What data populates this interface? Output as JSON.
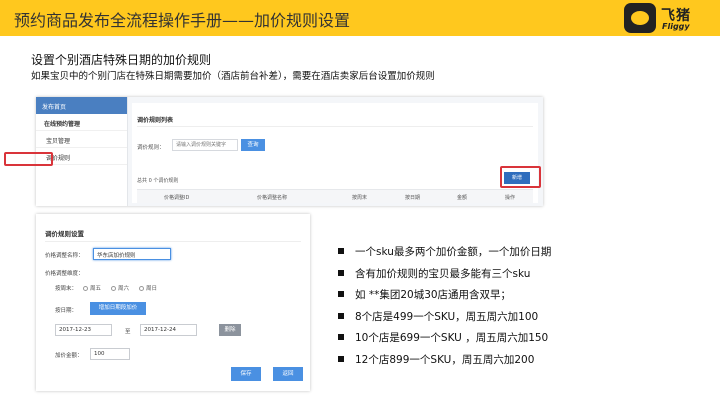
{
  "header": {
    "title": "预约商品发布全流程操作手册——加价规则设置",
    "logo_cn": "飞猪",
    "logo_en": "Fliggy"
  },
  "intro": {
    "heading": "设置个别酒店特殊日期的加价规则",
    "description": "如果宝贝中的个别门店在特殊日期需要加价（酒店前台补差），需要在酒店卖家后台设置加价规则"
  },
  "screenshot_list": {
    "sidebar": {
      "header": "发布首页",
      "items": [
        "在线预约管理",
        "宝贝管理",
        "调价规则"
      ]
    },
    "title": "调价规则列表",
    "filter_label": "调价规则：",
    "filter_placeholder": "请输入调价规则关键字",
    "query_button": "查询",
    "count_text": "总共 0 个调价规则",
    "add_button": "新增",
    "columns": [
      "价格调整ID",
      "价格调整名称",
      "按周末",
      "按日期",
      "金额",
      "操作"
    ]
  },
  "screenshot_form": {
    "title": "调价规则设置",
    "name_label": "价格调整名称：",
    "name_value": "华东店加价规则",
    "dim_label": "价格调整维度：",
    "weekend_label": "按周末：",
    "weekend_options": [
      "周五",
      "周六",
      "周日"
    ],
    "date_label": "按日期：",
    "add_date_button": "增加日期段加价",
    "start_date": "2017-12-23",
    "to_text": "至",
    "end_date": "2017-12-24",
    "delete_button": "删除",
    "amount_label": "加价金额：",
    "amount_value": "100",
    "save_button": "保存",
    "back_button": "返回"
  },
  "bullets": [
    "一个sku最多两个加价金额，一个加价日期",
    "含有加价规则的宝贝最多能有三个sku",
    "如 **集团20城30店通用含双早；",
    "8个店是499一个SKU，周五周六加100",
    "10个店是699一个SKU ，周五周六加150",
    "12个店899一个SKU，周五周六加200"
  ],
  "colors": {
    "header_bg": "#ffc81e",
    "accent_blue": "#4a90e2",
    "highlight_red": "#d9343a"
  }
}
